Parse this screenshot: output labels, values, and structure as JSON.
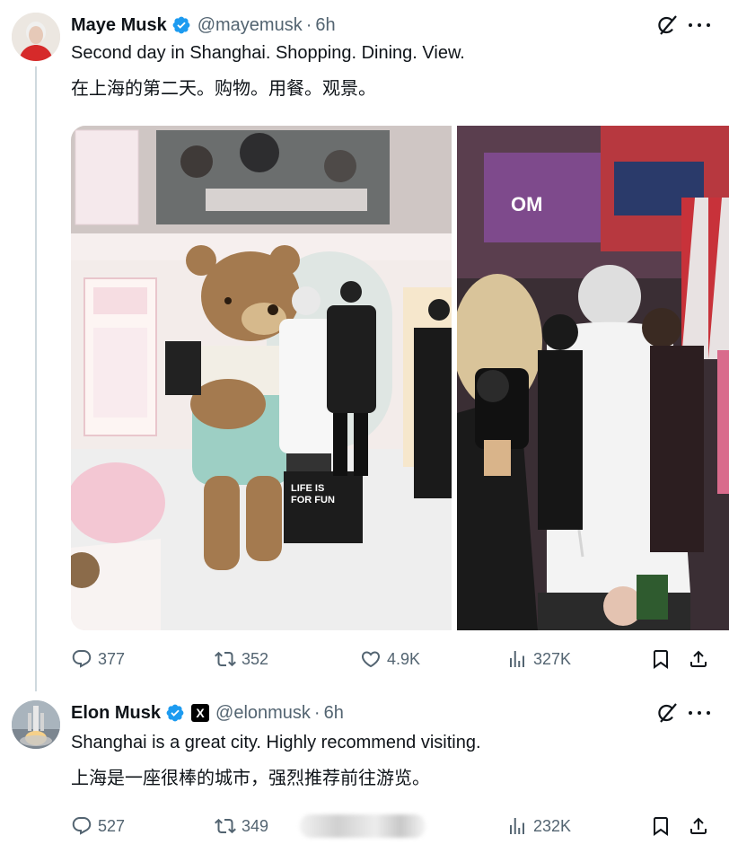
{
  "tweets": [
    {
      "author": {
        "name": "Maye Musk",
        "handle": "@mayemusk",
        "time": "6h"
      },
      "text_en": "Second day in Shanghai. Shopping. Dining. View.",
      "text_zh": "在上海的第二天。购物。用餐。观景。",
      "media": [
        {
          "overlay_bag_text": "LIFE IS FOR FUN"
        },
        {
          "overlay_sign_text": "OM"
        }
      ],
      "stats": {
        "replies": "377",
        "reposts": "352",
        "likes": "4.9K",
        "views": "327K"
      }
    },
    {
      "author": {
        "name": "Elon Musk",
        "handle": "@elonmusk",
        "time": "6h",
        "affiliate_badge": "X"
      },
      "text_en": "Shanghai is a great city. Highly recommend visiting.",
      "text_zh": "上海是一座很棒的城市，强烈推荐前往游览。",
      "stats": {
        "replies": "527",
        "reposts": "349",
        "views": "232K"
      }
    }
  ],
  "colors": {
    "verified": "#1d9bf0",
    "muted": "#536471",
    "thread_line": "#cfd9de",
    "text": "#0f1419"
  },
  "icons": [
    "verified-badge-icon",
    "grok-icon",
    "more-icon",
    "reply-icon",
    "repost-icon",
    "like-icon",
    "views-icon",
    "bookmark-icon",
    "share-icon"
  ]
}
